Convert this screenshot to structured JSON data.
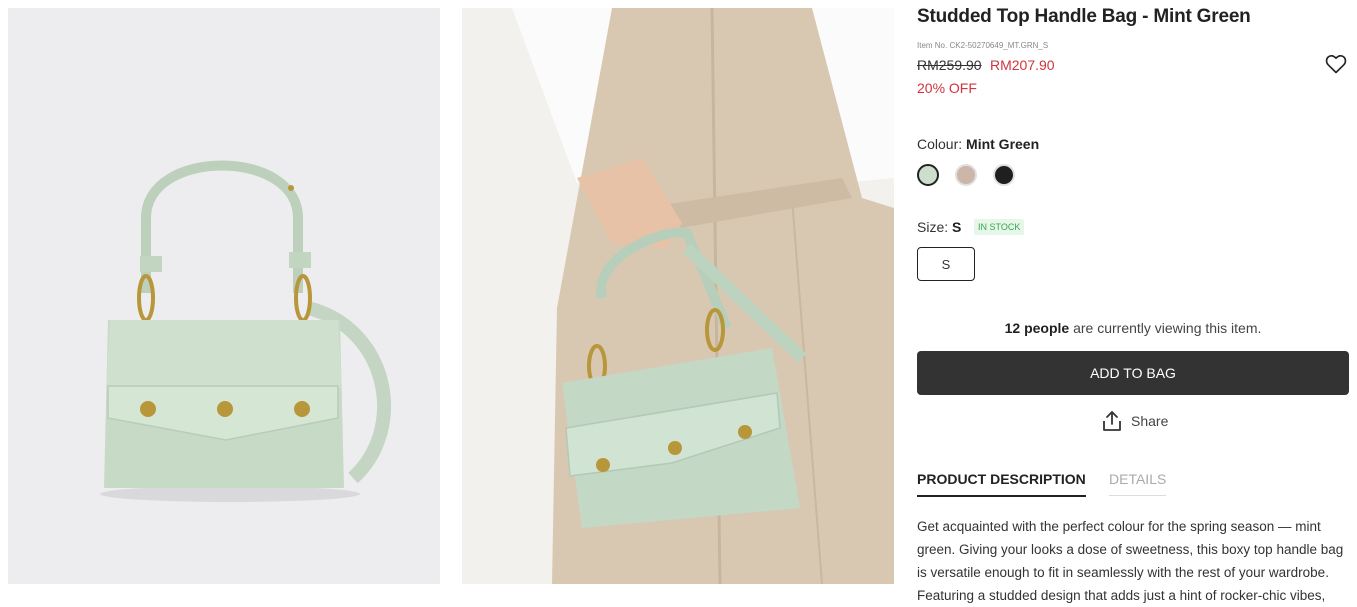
{
  "product": {
    "title": "Studded Top Handle Bag - Mint Green",
    "item_no": "Item No. CK2-50270649_MT.GRN_S",
    "price_old": "RM259.90",
    "price_new": "RM207.90",
    "discount": "20% OFF"
  },
  "colour": {
    "label": "Colour: ",
    "selected": "Mint Green",
    "swatches": [
      "#cddfcc",
      "#cbb6a8",
      "#1f1f1f"
    ]
  },
  "size": {
    "label": "Size: ",
    "selected": "S",
    "stock": "IN STOCK",
    "option": "S"
  },
  "viewers": {
    "count": "12 people",
    "text": " are currently viewing this item."
  },
  "actions": {
    "add_to_bag": "ADD TO BAG",
    "share": "Share"
  },
  "tabs": [
    "PRODUCT DESCRIPTION",
    "DETAILS"
  ],
  "description": [
    "Get acquainted with the perfect colour for the spring season — mint",
    "green. Giving your looks a dose of sweetness, this boxy top handle bag",
    "is versatile enough to fit in seamlessly with the rest of your wardrobe.",
    "Featuring a studded design that adds just a hint of rocker-chic vibes,"
  ],
  "colors": {
    "accent_red": "#d0343c",
    "button_dark": "#333333",
    "in_stock_green": "#3aa653"
  }
}
